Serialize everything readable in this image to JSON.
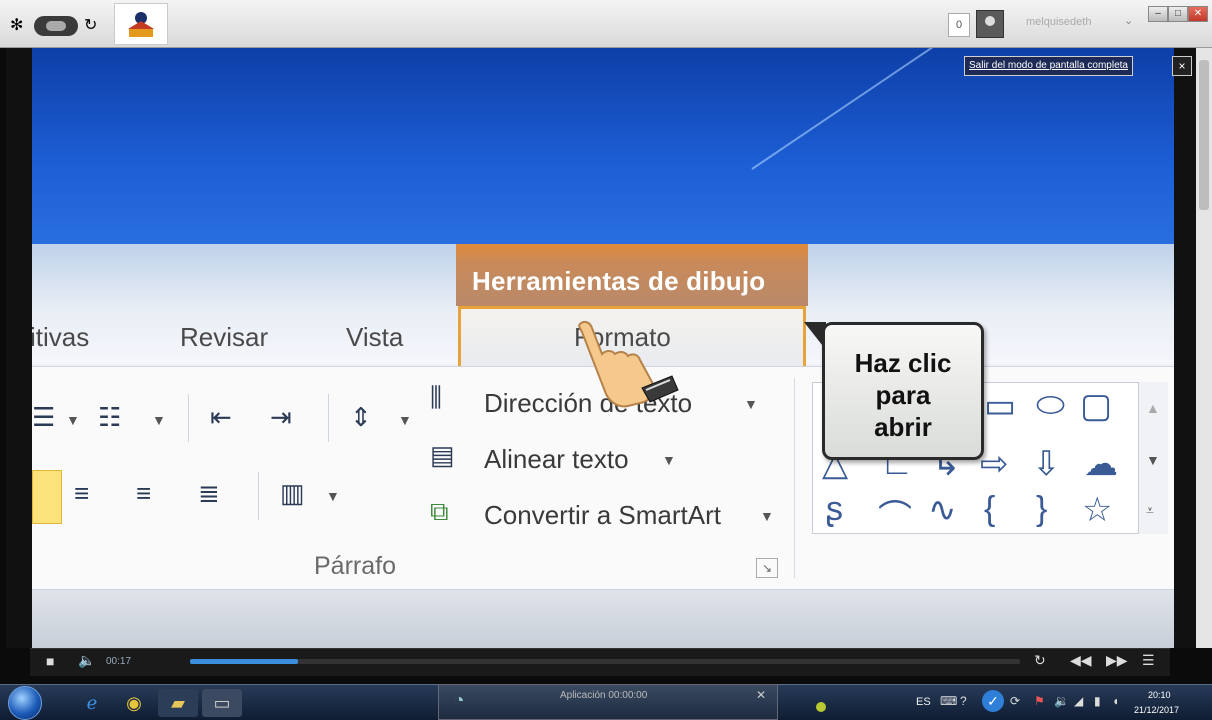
{
  "topbar": {
    "counter": "0",
    "username": "melquisedeth"
  },
  "overlay": {
    "exit_fullscreen": "Salir del modo de pantalla completa",
    "exit_close": "×"
  },
  "ribbon": {
    "contextual_header": "Herramientas de dibujo",
    "tabs": [
      {
        "label": "itivas"
      },
      {
        "label": "Revisar"
      },
      {
        "label": "Vista"
      },
      {
        "label": "Formato"
      }
    ],
    "commands": {
      "text_direction": "Dirección de texto",
      "align_text": "Alinear texto",
      "convert_smartart": "Convertir a SmartArt"
    },
    "group_label": "Párrafo"
  },
  "callout": {
    "text": "Haz clic\npara\nabrir"
  },
  "player": {
    "time": "00:17",
    "progress_fraction": 0.13
  },
  "taskbar": {
    "active_task_label": "Aplicación 00:00:00",
    "lang": "ES",
    "time": "20:10",
    "date": "21/12/2017"
  },
  "colors": {
    "contextual_tab": "#e8a23a",
    "banner_blue": "#1d5fd6",
    "progress": "#3b8edb"
  }
}
